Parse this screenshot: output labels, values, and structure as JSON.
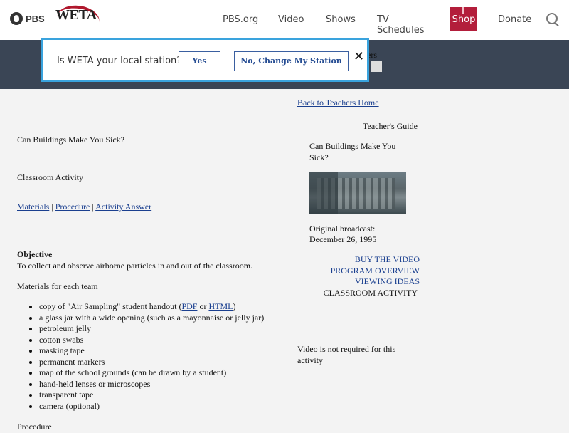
{
  "header": {
    "pbs_logo_text": "PBS",
    "weta_logo_text": "WETA",
    "nav": [
      {
        "label": "PBS.org"
      },
      {
        "label": "Video"
      },
      {
        "label": "Shows"
      },
      {
        "label": "TV Schedules"
      },
      {
        "label": "Shop"
      },
      {
        "label": "Donate"
      }
    ],
    "colors": {
      "shop_bg": "#b31e3b",
      "band_bg": "#3a4555",
      "popup_border": "#3aa3dd"
    }
  },
  "band": {
    "partial_text": "ers"
  },
  "popup": {
    "question": "Is WETA your local station?",
    "yes_label": "Yes",
    "change_label": "No, Change My Station",
    "close_glyph": "✕"
  },
  "left": {
    "title": "Can Buildings Make You Sick?",
    "subtitle": "Classroom Activity",
    "links": [
      {
        "label": "Materials"
      },
      {
        "label": "Procedure"
      },
      {
        "label": "Activity Answer"
      }
    ],
    "separator": "|",
    "objective_heading": "Objective",
    "objective_text": "To collect and observe airborne particles in and out of the classroom.",
    "materials_heading": "Materials for each team",
    "materials": [
      {
        "text_before": "copy of \"Air Sampling\" student handout (",
        "link1": "PDF",
        "mid": " or ",
        "link2": "HTML",
        "text_after": ")"
      },
      {
        "text": "a glass jar with a wide opening (such as a mayonnaise or jelly jar)"
      },
      {
        "text": "petroleum jelly"
      },
      {
        "text": "cotton swabs"
      },
      {
        "text": "masking tape"
      },
      {
        "text": "permanent markers"
      },
      {
        "text": "map of the school grounds (can be drawn by a student)"
      },
      {
        "text": "hand-held lenses or microscopes"
      },
      {
        "text": "transparent tape"
      },
      {
        "text": "camera (optional)"
      }
    ],
    "procedure_heading": "Procedure"
  },
  "right": {
    "back_link": "Back to Teachers Home",
    "guide_label": "Teacher's Guide",
    "program_title": "Can Buildings Make You Sick?",
    "broadcast_label": "Original broadcast:",
    "broadcast_date": "December 26, 1995",
    "menu": [
      {
        "label": "BUY THE VIDEO"
      },
      {
        "label": "PROGRAM OVERVIEW"
      },
      {
        "label": "VIEWING IDEAS"
      },
      {
        "label": "CLASSROOM ACTIVITY"
      }
    ],
    "video_note": "Video is not required for this activity"
  }
}
